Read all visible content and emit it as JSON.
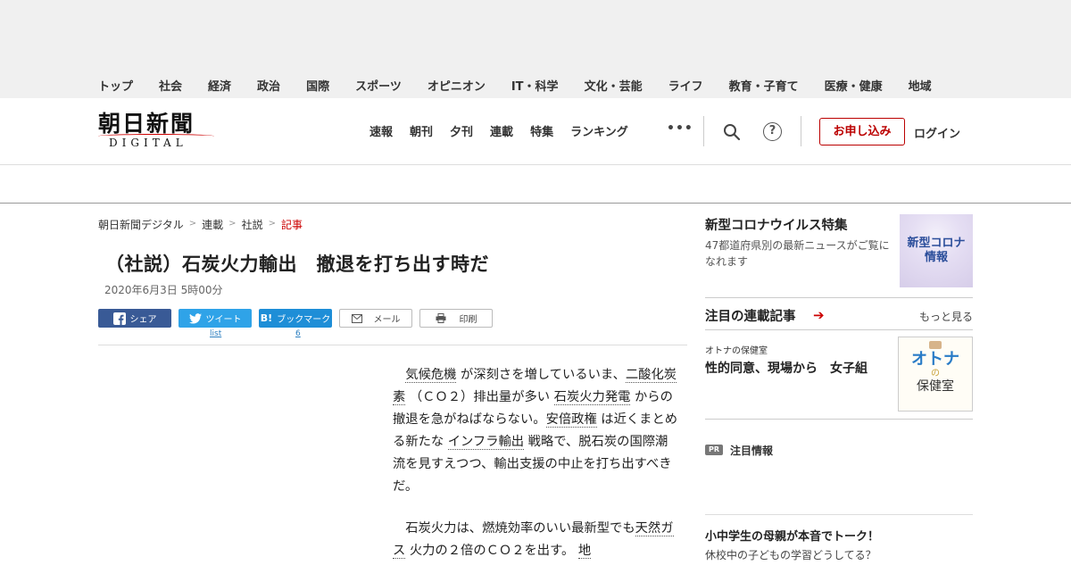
{
  "header": {
    "logo_main": "朝日新聞",
    "logo_sub": "DIGITAL",
    "top_nav": [
      "速報",
      "朝刊",
      "夕刊",
      "連載",
      "特集",
      "ランキング"
    ],
    "more_label": "•••",
    "help_label": "?",
    "apply_label": "お申し込み",
    "login_label": "ログイン",
    "categories": [
      "トップ",
      "社会",
      "経済",
      "政治",
      "国際",
      "スポーツ",
      "オピニオン",
      "IT・科学",
      "文化・芸能",
      "ライフ",
      "教育・子育て",
      "医療・健康",
      "地域"
    ]
  },
  "breadcrumb": [
    "朝日新聞デジタル",
    "連載",
    "社説",
    "記事"
  ],
  "breadcrumb_sep": ">",
  "article": {
    "title": "（社説）石炭火力輸出　撤退を打ち出す時だ",
    "date": "2020年6月3日 5時00分"
  },
  "share": {
    "facebook": "シェア",
    "twitter": "ツイート",
    "hatena": "ブックマーク",
    "hatena_icon": "B!",
    "mail": "メール",
    "print": "印刷",
    "twitter_count": "list",
    "hatena_count": "6"
  },
  "body": {
    "p1": [
      {
        "t": "気候危機",
        "kw": true
      },
      {
        "t": " が深刻さを増しているいま、",
        "kw": false
      },
      {
        "t": "二酸化炭素",
        "kw": true
      },
      {
        "t": " （ＣＯ２）排出量が多い ",
        "kw": false
      },
      {
        "t": "石炭火力発電",
        "kw": true
      },
      {
        "t": " からの撤退を急がねばならない。",
        "kw": false
      },
      {
        "t": "安倍政権",
        "kw": true
      },
      {
        "t": " は近くまとめる新たな ",
        "kw": false
      },
      {
        "t": "インフラ輸出",
        "kw": true
      },
      {
        "t": " 戦略で、脱石炭の国際潮流を見すえつつ、輸出支援の中止を打ち出すべきだ。",
        "kw": false
      }
    ],
    "p2": [
      {
        "t": "石炭火力は、燃焼効率のいい最新型でも",
        "kw": false
      },
      {
        "t": "天然ガス",
        "kw": true
      },
      {
        "t": " 火力の２倍のＣＯ２を出す。 ",
        "kw": false
      },
      {
        "t": "地",
        "kw": true
      }
    ]
  },
  "sidebar": {
    "corona_title": "新型コロナウイルス特集",
    "corona_desc": "47都道府県別の最新ニュースがご覧になれます",
    "corona_img": [
      "新型コロナ",
      "情報"
    ],
    "serial_title": "注目の連載記事",
    "serial_arrow": "➔",
    "more_label": "もっと見る",
    "serial_kicker": "オトナの保健室",
    "serial_heading": "性的同意、現場から　女子組",
    "otona_main": "オトナ",
    "otona_no": "の",
    "otona_sub": "保健室",
    "pr_badge": "PR",
    "pr_label": "注目情報",
    "pr_item_title": "小中学生の母親が本音でトーク！",
    "pr_item_desc": "休校中の子どもの学習どうしてる？"
  }
}
